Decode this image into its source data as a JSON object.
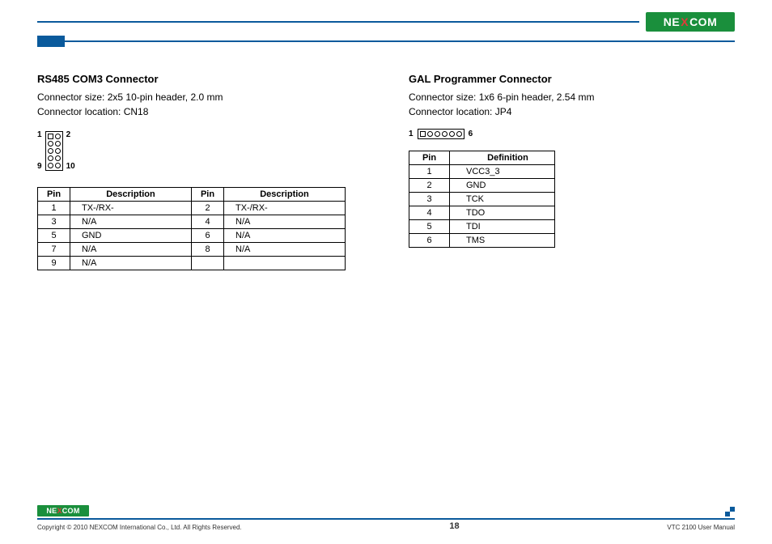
{
  "brand": {
    "name_pre": "NE",
    "name_mid": "X",
    "name_post": "COM"
  },
  "section1": {
    "title": "RS485 COM3 Connector",
    "size": "Connector size:  2x5 10-pin header, 2.0 mm",
    "location": "Connector location: CN18",
    "pins": {
      "tl": "1",
      "tr": "2",
      "bl": "9",
      "br": "10"
    },
    "table": {
      "headers": [
        "Pin",
        "Description",
        "Pin",
        "Description"
      ],
      "rows": [
        [
          "1",
          "TX-/RX-",
          "2",
          "TX-/RX-"
        ],
        [
          "3",
          "N/A",
          "4",
          "N/A"
        ],
        [
          "5",
          "GND",
          "6",
          "N/A"
        ],
        [
          "7",
          "N/A",
          "8",
          "N/A"
        ],
        [
          "9",
          "N/A",
          "",
          ""
        ]
      ]
    }
  },
  "section2": {
    "title": "GAL Programmer Connector",
    "size": "Connector size:  1x6 6-pin header, 2.54 mm",
    "location": "Connector location: JP4",
    "pins": {
      "l": "1",
      "r": "6"
    },
    "table": {
      "headers": [
        "Pin",
        "Definition"
      ],
      "rows": [
        [
          "1",
          "VCC3_3"
        ],
        [
          "2",
          "GND"
        ],
        [
          "3",
          "TCK"
        ],
        [
          "4",
          "TDO"
        ],
        [
          "5",
          "TDI"
        ],
        [
          "6",
          "TMS"
        ]
      ]
    }
  },
  "footer": {
    "copyright": "Copyright © 2010 NEXCOM International Co., Ltd. All Rights Reserved.",
    "page": "18",
    "manual": "VTC 2100 User Manual"
  }
}
